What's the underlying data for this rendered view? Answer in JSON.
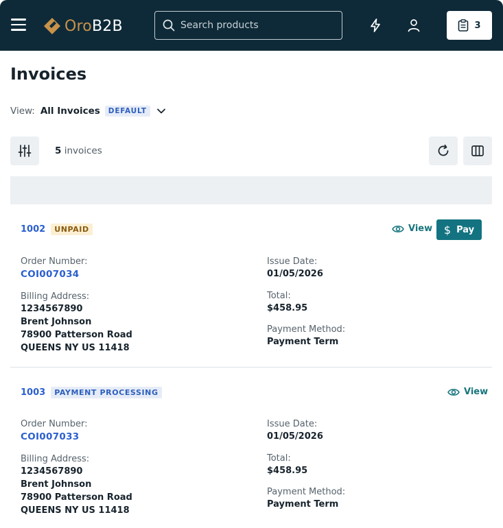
{
  "header": {
    "logo": {
      "oro": "Oro",
      "b2b": "B2B"
    },
    "search_placeholder": "Search products",
    "cart_count": "3"
  },
  "page": {
    "title": "Invoices",
    "view_label": "View:",
    "view_name": "All Invoices",
    "view_badge": "DEFAULT",
    "count_number": "5",
    "count_suffix": "invoices"
  },
  "labels": {
    "order_number": "Order Number:",
    "billing_address": "Billing Address:",
    "issue_date": "Issue Date:",
    "total": "Total:",
    "payment_method": "Payment Method:",
    "view": "View",
    "pay": "Pay",
    "pay_symbol": "$"
  },
  "invoices": [
    {
      "id": "1002",
      "status": "UNPAID",
      "order_number": "COI007034",
      "address": [
        "1234567890",
        "Brent Johnson",
        "78900 Patterson Road",
        "QUEENS NY US 11418"
      ],
      "issue_date": "01/05/2026",
      "total": "$458.95",
      "payment_method": "Payment Term"
    },
    {
      "id": "1003",
      "status": "PAYMENT PROCESSING",
      "order_number": "COI007033",
      "address": [
        "1234567890",
        "Brent Johnson",
        "78900 Patterson Road",
        "QUEENS NY US 11418"
      ],
      "issue_date": "01/05/2026",
      "total": "$458.95",
      "payment_method": "Payment Term"
    }
  ],
  "colors": {
    "header_bg": "#0e2a38",
    "accent_teal": "#137381",
    "link_blue": "#2b5fcf",
    "unpaid_bg": "#fbefd3",
    "processing_bg": "#e6ecf7"
  }
}
